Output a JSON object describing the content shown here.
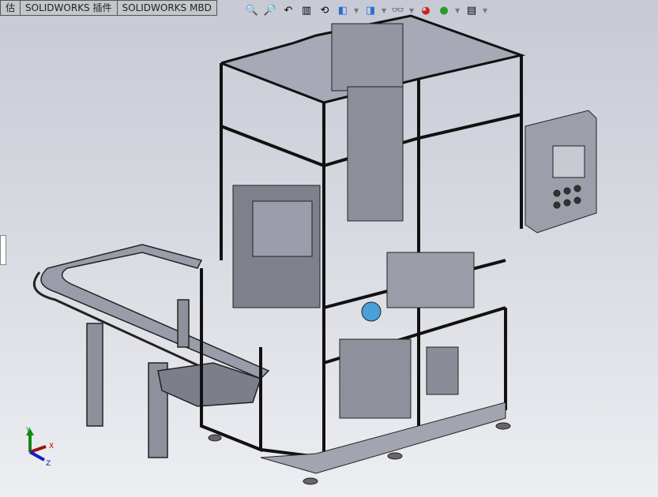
{
  "tabs": [
    {
      "label": "估"
    },
    {
      "label": "SOLIDWORKS 插件"
    },
    {
      "label": "SOLIDWORKS MBD"
    }
  ],
  "toolbar": [
    {
      "icon": "zoom-to-fit-icon",
      "glyph": "🔍"
    },
    {
      "icon": "zoom-area-icon",
      "glyph": "🔎"
    },
    {
      "icon": "previous-view-icon",
      "glyph": "↶"
    },
    {
      "icon": "section-view-icon",
      "glyph": "▥"
    },
    {
      "icon": "dynamic-annotation-icon",
      "glyph": "⟲"
    },
    {
      "icon": "view-orientation-icon",
      "glyph": "◧"
    },
    {
      "icon": "display-style-icon",
      "glyph": "◨"
    },
    {
      "icon": "hide-show-items-icon",
      "glyph": "👓"
    },
    {
      "icon": "edit-appearance-icon",
      "glyph": "◕"
    },
    {
      "icon": "apply-scene-icon",
      "glyph": "●"
    },
    {
      "icon": "view-settings-icon",
      "glyph": "▤"
    }
  ],
  "triad": {
    "x": "X",
    "y": "Y",
    "z": "Z",
    "colors": {
      "x": "#c00000",
      "y": "#118811",
      "z": "#1020c0"
    }
  }
}
